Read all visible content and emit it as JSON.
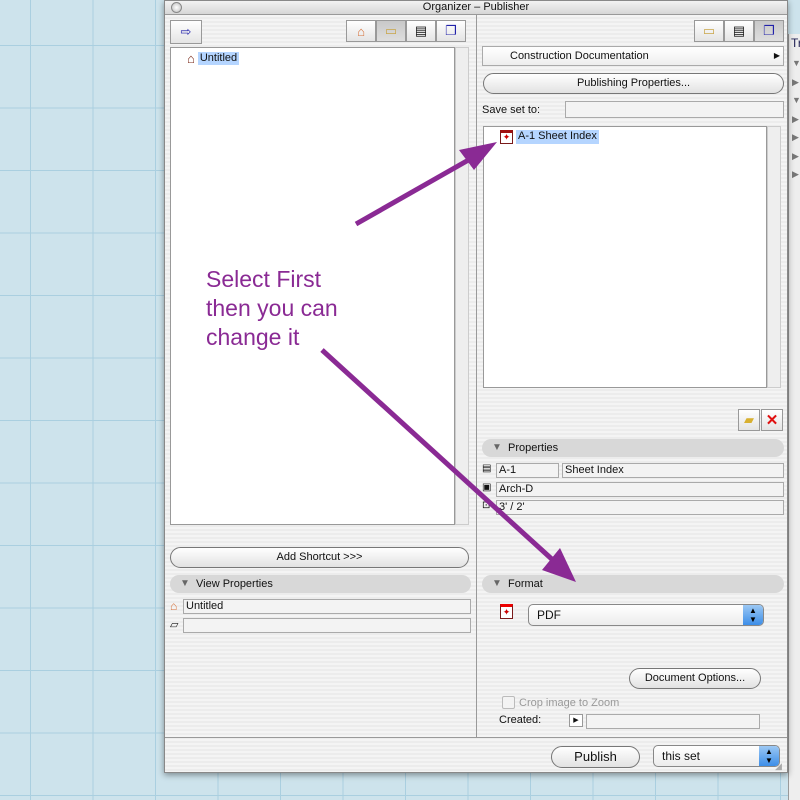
{
  "window": {
    "title": "Organizer – Publisher"
  },
  "left": {
    "tree_items": [
      {
        "label": "Untitled",
        "icon": "house-icon"
      }
    ],
    "add_shortcut": "Add Shortcut >>>",
    "view_properties": {
      "title": "View Properties",
      "name": "Untitled",
      "second": ""
    }
  },
  "right": {
    "set_popup": "Construction Documentation",
    "publishing_properties": "Publishing Properties...",
    "save_set_label": "Save set to:",
    "save_set_value": "",
    "items": [
      {
        "label": "A-1 Sheet Index",
        "icon": "pdf-icon"
      }
    ],
    "properties": {
      "title": "Properties",
      "id": "A-1",
      "name": "Sheet Index",
      "size": "Arch-D",
      "scale": "3' / 2'"
    },
    "format": {
      "title": "Format",
      "value": "PDF",
      "document_options": "Document Options...",
      "crop_label": "Crop image to Zoom",
      "crop_checked": false,
      "created_label": "Created:",
      "created_value": ""
    }
  },
  "footer": {
    "publish": "Publish",
    "scope": "this set"
  },
  "annotation": {
    "line1": "Select First",
    "line2": "then you can",
    "line3": "change it",
    "color": "#8a2a94"
  },
  "side_window": {
    "title_fragment": "Tr"
  }
}
